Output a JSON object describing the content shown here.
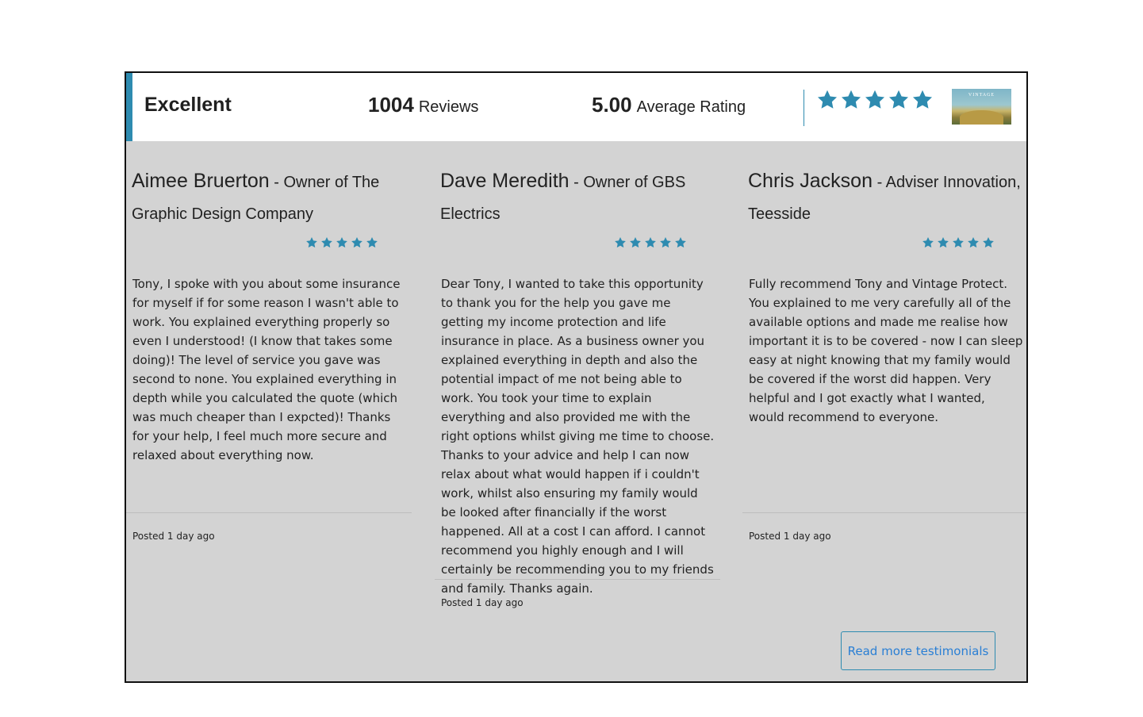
{
  "summary": {
    "rating_word": "Excellent",
    "review_count": "1004",
    "review_count_label": "Reviews",
    "average_rating": "5.00",
    "average_rating_label": "Average Rating",
    "stars": 5
  },
  "logo": {
    "text": "VINTAGE"
  },
  "colors": {
    "accent": "#2e8bb0",
    "star": "#2e8bb0",
    "panel_bg": "#d3d3d3",
    "link": "#2a7fd4"
  },
  "reviews": [
    {
      "name": "Aimee Bruerton",
      "role": "- Owner of The Graphic Design Company",
      "stars": 5,
      "text": "Tony, I spoke with you about some insurance for myself if for some reason I wasn't able to work. You explained everything properly so even I understood! (I know that takes some doing)! The level of service you gave was second to none. You explained everything in depth while you calculated the quote (which was much cheaper than I expcted)! Thanks for your help, I feel much more secure and relaxed about everything now.",
      "posted": "Posted 1 day ago"
    },
    {
      "name": "Dave Meredith",
      "role": "- Owner of GBS Electrics",
      "stars": 5,
      "text": "Dear Tony, I wanted to take this opportunity to thank you for the help you gave me getting my income protection and life insurance in place. As a business owner you explained everything in depth and also the potential impact of me not being able to work. You took your time to explain everything and also provided me with the right options whilst giving me time to choose. Thanks to your advice and help I can now relax about what would happen if i couldn't work, whilst also ensuring my family would be looked after financially if the worst happened. All at a cost I can afford. I cannot recommend you highly enough and I will certainly be recommending you to my friends and family. Thanks again.",
      "posted": "Posted 1 day ago"
    },
    {
      "name": "Chris Jackson",
      "role": "- Adviser Innovation, Teesside",
      "stars": 5,
      "text": "Fully recommend Tony and Vintage Protect. You explained to me very carefully all of the available options and made me realise how important it is to be covered - now I can sleep easy at night knowing that my family would be covered if the worst did happen. Very helpful and I got exactly what I wanted, would recommend to everyone.",
      "posted": "Posted 1 day ago"
    }
  ],
  "more_button": {
    "label": "Read more testimonials"
  }
}
